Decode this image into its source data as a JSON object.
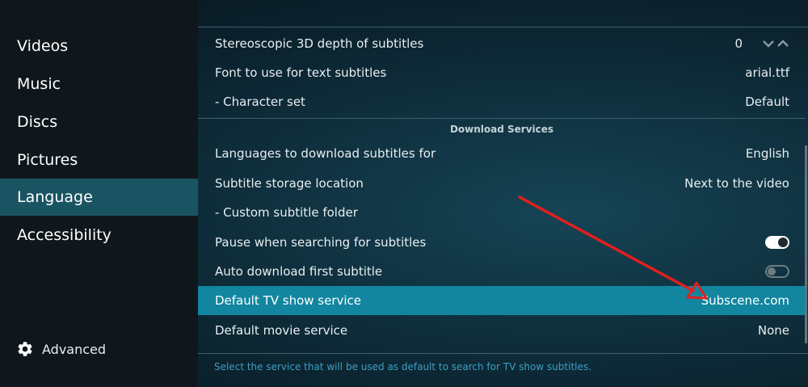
{
  "sidebar": {
    "items": [
      {
        "label": "Videos"
      },
      {
        "label": "Music"
      },
      {
        "label": "Discs"
      },
      {
        "label": "Pictures"
      },
      {
        "label": "Language"
      },
      {
        "label": "Accessibility"
      }
    ],
    "active_item": "Language",
    "advanced_label": "Advanced"
  },
  "settings": {
    "rows_top": [
      {
        "label": "Stereoscopic 3D depth of subtitles",
        "value": "0"
      },
      {
        "label": "Font to use for text subtitles",
        "value": "arial.ttf"
      },
      {
        "label": "- Character set",
        "value": "Default"
      }
    ],
    "section_title": "Download Services",
    "rows_download": [
      {
        "label": "Languages to download subtitles for",
        "value": "English"
      },
      {
        "label": "Subtitle storage location",
        "value": "Next to the video"
      },
      {
        "label": "- Custom subtitle folder",
        "value": ""
      },
      {
        "label": "Pause when searching for subtitles",
        "toggle": true
      },
      {
        "label": "Auto download first subtitle",
        "toggle": false
      },
      {
        "label": "Default TV show service",
        "value": "Subscene.com"
      },
      {
        "label": "Default movie service",
        "value": "None"
      }
    ],
    "selected_row": "Default TV show service",
    "description": "Select the service that will be used as default to search for TV show subtitles."
  },
  "colors": {
    "selected_row": "#12869f",
    "sidebar_active": "#1a5463",
    "annotation_arrow": "#e0201f",
    "description_text": "#3c9fc4"
  }
}
